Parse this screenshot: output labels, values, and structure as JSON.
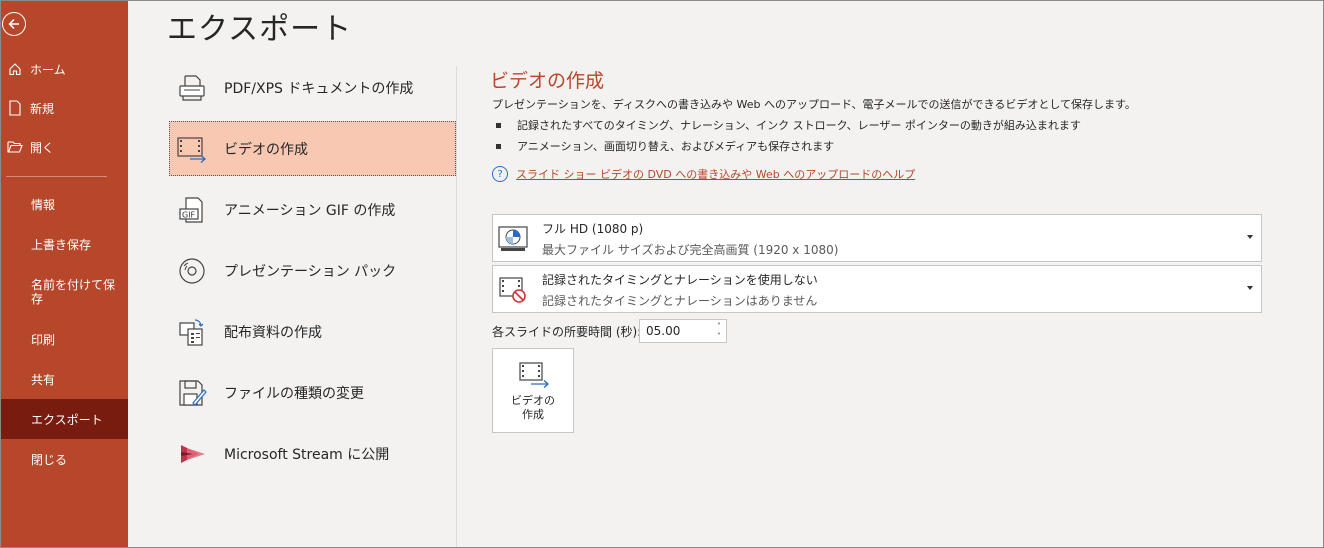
{
  "page": {
    "title": "エクスポート"
  },
  "sidebar": {
    "items": [
      {
        "label": "ホーム",
        "icon": "home-icon"
      },
      {
        "label": "新規",
        "icon": "new-document-icon"
      },
      {
        "label": "開く",
        "icon": "folder-open-icon"
      },
      {
        "label": "情報"
      },
      {
        "label": "上書き保存"
      },
      {
        "label": "名前を付けて保存"
      },
      {
        "label": "印刷"
      },
      {
        "label": "共有"
      },
      {
        "label": "エクスポート",
        "active": true
      },
      {
        "label": "閉じる"
      }
    ]
  },
  "options": [
    {
      "label": "PDF/XPS ドキュメントの作成",
      "icon": "pdf-xps-icon"
    },
    {
      "label": "ビデオの作成",
      "icon": "video-icon",
      "selected": true
    },
    {
      "label": "アニメーション GIF の作成",
      "icon": "gif-icon"
    },
    {
      "label": "プレゼンテーション パック",
      "icon": "cd-package-icon"
    },
    {
      "label": "配布資料の作成",
      "icon": "handouts-icon"
    },
    {
      "label": "ファイルの種類の変更",
      "icon": "change-file-type-icon"
    },
    {
      "label": "Microsoft Stream に公開",
      "icon": "microsoft-stream-icon"
    }
  ],
  "detail": {
    "title": "ビデオの作成",
    "description": "プレゼンテーションを、ディスクへの書き込みや Web へのアップロード、電子メールでの送信ができるビデオとして保存します。",
    "bullets": [
      "記録されたすべてのタイミング、ナレーション、インク ストローク、レーザー ポインターの動きが組み込まれます",
      "アニメーション、画面切り替え、およびメディアも保存されます"
    ],
    "help_link": "スライド ショー ビデオの DVD への書き込みや Web へのアップロードのヘルプ",
    "quality": {
      "main": "フル HD (1080 p)",
      "sub": "最大ファイル サイズおよび完全高画質 (1920 x 1080)"
    },
    "timing": {
      "main": "記録されたタイミングとナレーションを使用しない",
      "sub": "記録されたタイミングとナレーションはありません"
    },
    "seconds_label": "各スライドの所要時間 (秒):",
    "seconds_value": "05.00",
    "create_button": {
      "line1": "ビデオの",
      "line2": "作成"
    }
  },
  "colors": {
    "accent": "#b7472a",
    "sidebar_active": "#781c10",
    "selected_bg": "#f9c8b3"
  }
}
